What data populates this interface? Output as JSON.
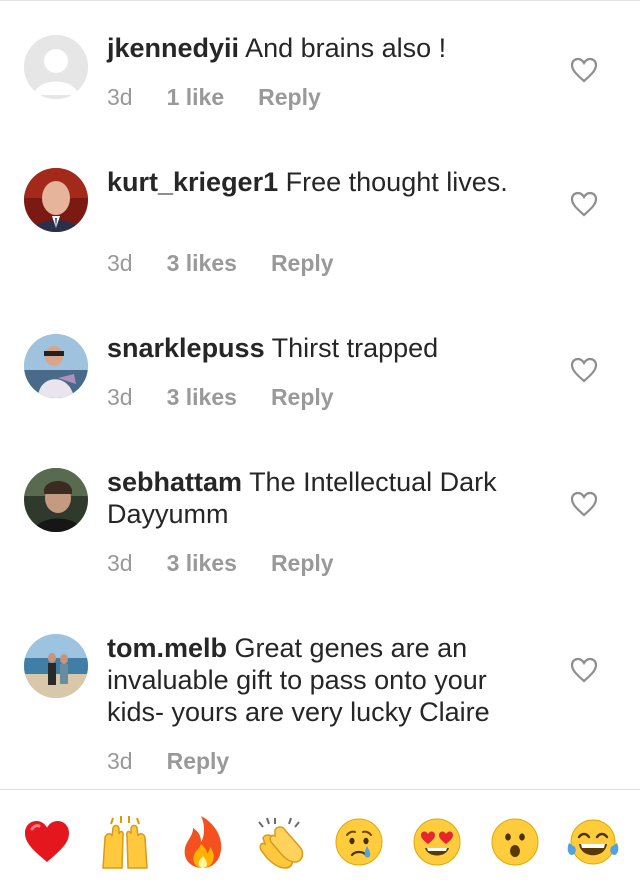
{
  "comments": [
    {
      "username": "jkennedyii",
      "text": "And brains also !",
      "time": "3d",
      "likes": "1 like",
      "reply": "Reply",
      "avatar": "default-avatar"
    },
    {
      "username": "kurt_krieger1",
      "text": "Free thought lives.",
      "time": "3d",
      "likes": "3 likes",
      "reply": "Reply",
      "avatar": "photo-avatar"
    },
    {
      "username": "snarklepuss",
      "text": "Thirst trapped",
      "time": "3d",
      "likes": "3 likes",
      "reply": "Reply",
      "avatar": "photo-avatar"
    },
    {
      "username": "sebhattam",
      "text": "The Intellectual Dark Dayyumm",
      "time": "3d",
      "likes": "3 likes",
      "reply": "Reply",
      "avatar": "photo-avatar"
    },
    {
      "username": "tom.melb",
      "text": "Great genes are an invaluable gift to pass onto your kids- yours are very lucky Claire",
      "time": "3d",
      "likes": "",
      "reply": "Reply",
      "avatar": "photo-avatar"
    }
  ],
  "emoji_bar": [
    "❤️",
    "🙌",
    "🔥",
    "👏",
    "😢",
    "😍",
    "😮",
    "😂"
  ],
  "colors": {
    "text": "#262626",
    "meta": "#999999",
    "divider": "#dbdbdb"
  }
}
